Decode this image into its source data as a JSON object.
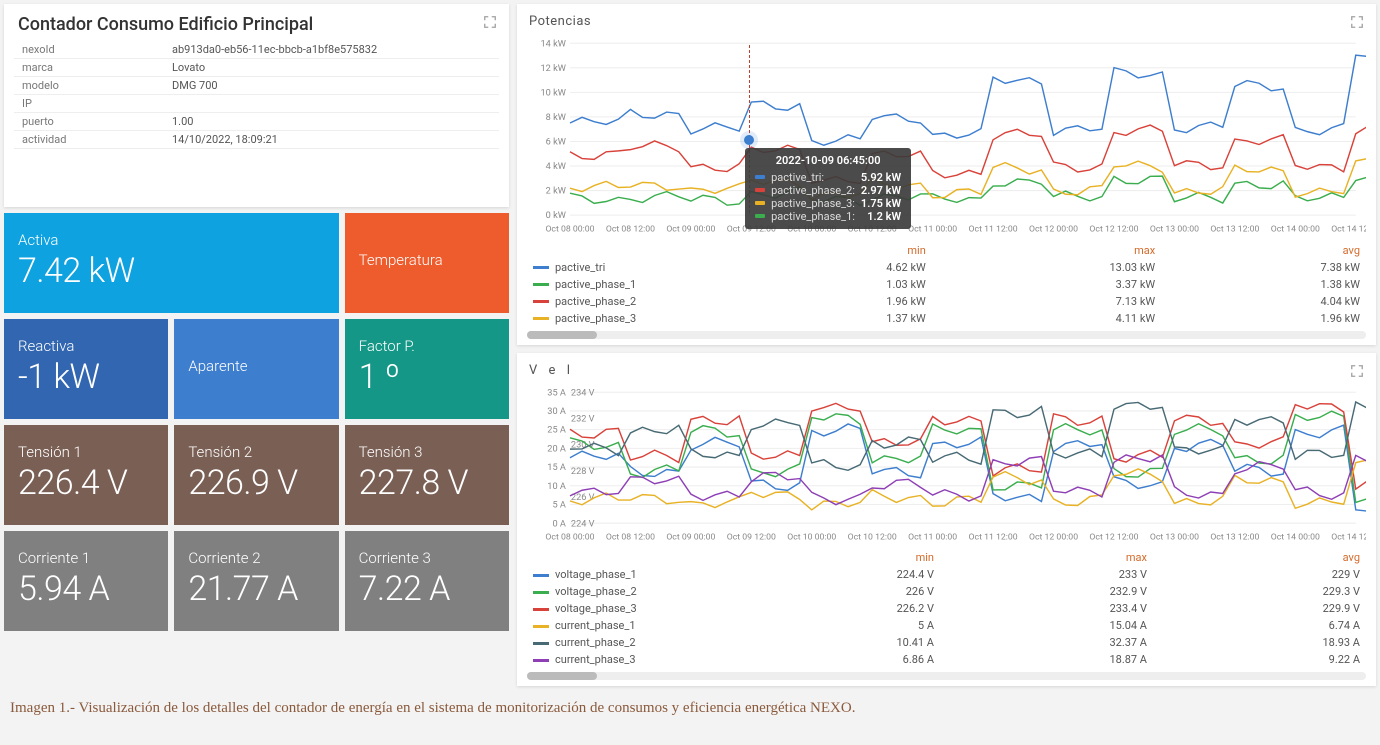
{
  "info_panel": {
    "title": "Contador Consumo Edificio Principal",
    "rows": [
      {
        "k": "nexoId",
        "v": "ab913da0-eb56-11ec-bbcb-a1bf8e575832"
      },
      {
        "k": "marca",
        "v": "Lovato"
      },
      {
        "k": "modelo",
        "v": "DMG 700"
      },
      {
        "k": "IP",
        "v": ""
      },
      {
        "k": "puerto",
        "v": "1.00"
      },
      {
        "k": "actividad",
        "v": "14/10/2022, 18:09:21"
      }
    ]
  },
  "tiles": {
    "activa": {
      "label": "Activa",
      "value": "7.42 kW"
    },
    "temp": {
      "label": "Temperatura",
      "value": ""
    },
    "reactiva": {
      "label": "Reactiva",
      "value": "-1 kW"
    },
    "aparente": {
      "label": "Aparente",
      "value": ""
    },
    "factor": {
      "label": "Factor P.",
      "value": "1 º"
    },
    "t1": {
      "label": "Tensión 1",
      "value": "226.4 V"
    },
    "t2": {
      "label": "Tensión 2",
      "value": "226.9 V"
    },
    "t3": {
      "label": "Tensión 3",
      "value": "227.8 V"
    },
    "c1": {
      "label": "Corriente 1",
      "value": "5.94 A"
    },
    "c2": {
      "label": "Corriente 2",
      "value": "21.77 A"
    },
    "c3": {
      "label": "Corriente 3",
      "value": "7.22 A"
    }
  },
  "chart1": {
    "title": "Potencias",
    "ylabel": "kW",
    "yticks": [
      "0 kW",
      "2 kW",
      "4 kW",
      "6 kW",
      "8 kW",
      "10 kW",
      "12 kW",
      "14 kW"
    ],
    "xticks": [
      "Oct 08 00:00",
      "Oct 08 12:00",
      "Oct 09 00:00",
      "Oct 09 12:00",
      "Oct 10 00:00",
      "Oct 10 12:00",
      "Oct 11 00:00",
      "Oct 11 12:00",
      "Oct 12 00:00",
      "Oct 12 12:00",
      "Oct 13 00:00",
      "Oct 13 12:00",
      "Oct 14 00:00",
      "Oct 14 12:00"
    ],
    "headers": {
      "min": "min",
      "max": "max",
      "avg": "avg"
    },
    "series": [
      {
        "name": "pactive_tri",
        "color": "#3d7ece",
        "min": "4.62 kW",
        "max": "13.03 kW",
        "avg": "7.38 kW"
      },
      {
        "name": "pactive_phase_1",
        "color": "#3aae4e",
        "min": "1.03 kW",
        "max": "3.37 kW",
        "avg": "1.38 kW"
      },
      {
        "name": "pactive_phase_2",
        "color": "#d9423a",
        "min": "1.96 kW",
        "max": "7.13 kW",
        "avg": "4.04 kW"
      },
      {
        "name": "pactive_phase_3",
        "color": "#e8b224",
        "min": "1.37 kW",
        "max": "4.11 kW",
        "avg": "1.96 kW"
      }
    ],
    "tooltip": {
      "title": "2022-10-09 06:45:00",
      "rows": [
        {
          "name": "pactive_tri:",
          "val": "5.92 kW",
          "color": "#3d7ece"
        },
        {
          "name": "pactive_phase_2:",
          "val": "2.97 kW",
          "color": "#d9423a"
        },
        {
          "name": "pactive_phase_3:",
          "val": "1.75 kW",
          "color": "#e8b224"
        },
        {
          "name": "pactive_phase_1:",
          "val": "1.2 kW",
          "color": "#3aae4e"
        }
      ]
    }
  },
  "chart2": {
    "title": "V e I",
    "yticks_left": [
      "0 A",
      "5 A",
      "10 A",
      "15 A",
      "20 A",
      "25 A",
      "30 A",
      "35 A"
    ],
    "yticks_right": [
      "224 V",
      "226 V",
      "228 V",
      "230 V",
      "232 V",
      "234 V"
    ],
    "xticks": [
      "Oct 08 00:00",
      "Oct 08 12:00",
      "Oct 09 00:00",
      "Oct 09 12:00",
      "Oct 10 00:00",
      "Oct 10 12:00",
      "Oct 11 00:00",
      "Oct 11 12:00",
      "Oct 12 00:00",
      "Oct 12 12:00",
      "Oct 13 00:00",
      "Oct 13 12:00",
      "Oct 14 00:00",
      "Oct 14 12:00"
    ],
    "headers": {
      "min": "min",
      "max": "max",
      "avg": "avg"
    },
    "series": [
      {
        "name": "voltage_phase_1",
        "color": "#3d7ece",
        "min": "224.4 V",
        "max": "233 V",
        "avg": "229 V"
      },
      {
        "name": "voltage_phase_2",
        "color": "#3aae4e",
        "min": "226 V",
        "max": "232.9 V",
        "avg": "229.3 V"
      },
      {
        "name": "voltage_phase_3",
        "color": "#d9423a",
        "min": "226.2 V",
        "max": "233.4 V",
        "avg": "229.9 V"
      },
      {
        "name": "current_phase_1",
        "color": "#e8b224",
        "min": "5 A",
        "max": "15.04 A",
        "avg": "6.74 A"
      },
      {
        "name": "current_phase_2",
        "color": "#486a74",
        "min": "10.41 A",
        "max": "32.37 A",
        "avg": "18.93 A"
      },
      {
        "name": "current_phase_3",
        "color": "#8e3fb5",
        "min": "6.86 A",
        "max": "18.87 A",
        "avg": "9.22 A"
      }
    ]
  },
  "chart_data": [
    {
      "type": "line",
      "title": "Potencias",
      "ylabel": "kW",
      "ylim": [
        0,
        14
      ],
      "x": [
        "Oct 08 00:00",
        "Oct 08 12:00",
        "Oct 09 00:00",
        "Oct 09 12:00",
        "Oct 10 00:00",
        "Oct 10 12:00",
        "Oct 11 00:00",
        "Oct 11 12:00",
        "Oct 12 00:00",
        "Oct 12 12:00",
        "Oct 13 00:00",
        "Oct 13 12:00",
        "Oct 14 00:00",
        "Oct 14 12:00"
      ],
      "series": [
        {
          "name": "pactive_tri",
          "values": [
            7.5,
            8.3,
            7.0,
            9.0,
            6.0,
            8.0,
            6.5,
            11.0,
            7.0,
            11.5,
            7.2,
            10.5,
            7.0,
            13.0
          ]
        },
        {
          "name": "pactive_phase_1",
          "values": [
            1.3,
            1.5,
            1.2,
            1.8,
            1.2,
            1.6,
            1.2,
            2.8,
            1.4,
            3.0,
            1.3,
            2.6,
            1.3,
            3.2
          ]
        },
        {
          "name": "pactive_phase_2",
          "values": [
            5.0,
            5.5,
            4.0,
            5.2,
            3.0,
            4.8,
            3.5,
            6.5,
            4.0,
            6.8,
            4.2,
            6.0,
            4.0,
            7.0
          ]
        },
        {
          "name": "pactive_phase_3",
          "values": [
            2.2,
            2.5,
            2.0,
            2.8,
            1.6,
            2.5,
            1.8,
            3.8,
            2.0,
            4.0,
            2.0,
            3.6,
            2.0,
            4.1
          ]
        }
      ]
    },
    {
      "type": "line",
      "title": "V e I",
      "x": [
        "Oct 08 00:00",
        "Oct 08 12:00",
        "Oct 09 00:00",
        "Oct 09 12:00",
        "Oct 10 00:00",
        "Oct 10 12:00",
        "Oct 11 00:00",
        "Oct 11 12:00",
        "Oct 12 00:00",
        "Oct 12 12:00",
        "Oct 13 00:00",
        "Oct 13 12:00",
        "Oct 14 00:00",
        "Oct 14 12:00"
      ],
      "series": [
        {
          "name": "voltage_phase_1",
          "axis": "right",
          "values": [
            229,
            228,
            230,
            227,
            231,
            228,
            230,
            226,
            230,
            227,
            230,
            228,
            231,
            225
          ]
        },
        {
          "name": "voltage_phase_2",
          "axis": "right",
          "values": [
            230,
            228,
            231,
            228,
            232,
            229,
            231,
            227,
            231,
            228,
            231,
            229,
            232,
            226
          ]
        },
        {
          "name": "voltage_phase_3",
          "axis": "right",
          "values": [
            231,
            229,
            232,
            229,
            233,
            230,
            232,
            228,
            232,
            229,
            232,
            230,
            233,
            227
          ]
        },
        {
          "name": "current_phase_1",
          "axis": "left",
          "values": [
            6,
            7,
            5,
            8,
            5,
            7,
            6,
            12,
            6,
            13,
            6,
            11,
            6,
            15
          ]
        },
        {
          "name": "current_phase_2",
          "axis": "left",
          "values": [
            20,
            25,
            18,
            27,
            15,
            22,
            17,
            30,
            18,
            32,
            19,
            28,
            18,
            31
          ]
        },
        {
          "name": "current_phase_3",
          "axis": "left",
          "values": [
            9,
            11,
            8,
            12,
            7,
            10,
            8,
            16,
            9,
            17,
            8,
            15,
            8,
            18
          ]
        }
      ],
      "ylim_left": [
        0,
        35
      ],
      "ylim_right": [
        224,
        234
      ]
    }
  ],
  "caption": "Imagen 1.- Visualización de los detalles del contador de energía en el sistema de monitorización de consumos y eficiencia energética NEXO."
}
